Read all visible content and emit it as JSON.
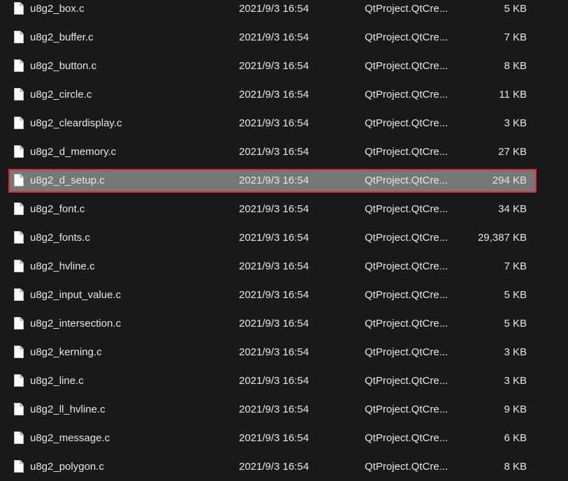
{
  "colors": {
    "background": "#191919",
    "text": "#e6e6e6",
    "selected_background": "#777777",
    "selected_border": "#e8262c",
    "icon_fill": "#ffffff"
  },
  "files": [
    {
      "name": "u8g2_box.c",
      "date": "2021/9/3 16:54",
      "type": "QtProject.QtCre...",
      "size": "5 KB",
      "icon": "document-icon",
      "selected": false
    },
    {
      "name": "u8g2_buffer.c",
      "date": "2021/9/3 16:54",
      "type": "QtProject.QtCre...",
      "size": "7 KB",
      "icon": "document-icon",
      "selected": false
    },
    {
      "name": "u8g2_button.c",
      "date": "2021/9/3 16:54",
      "type": "QtProject.QtCre...",
      "size": "8 KB",
      "icon": "document-icon",
      "selected": false
    },
    {
      "name": "u8g2_circle.c",
      "date": "2021/9/3 16:54",
      "type": "QtProject.QtCre...",
      "size": "11 KB",
      "icon": "document-icon",
      "selected": false
    },
    {
      "name": "u8g2_cleardisplay.c",
      "date": "2021/9/3 16:54",
      "type": "QtProject.QtCre...",
      "size": "3 KB",
      "icon": "document-icon",
      "selected": false
    },
    {
      "name": "u8g2_d_memory.c",
      "date": "2021/9/3 16:54",
      "type": "QtProject.QtCre...",
      "size": "27 KB",
      "icon": "document-icon",
      "selected": false
    },
    {
      "name": "u8g2_d_setup.c",
      "date": "2021/9/3 16:54",
      "type": "QtProject.QtCre...",
      "size": "294 KB",
      "icon": "document-icon",
      "selected": true
    },
    {
      "name": "u8g2_font.c",
      "date": "2021/9/3 16:54",
      "type": "QtProject.QtCre...",
      "size": "34 KB",
      "icon": "document-icon",
      "selected": false
    },
    {
      "name": "u8g2_fonts.c",
      "date": "2021/9/3 16:54",
      "type": "QtProject.QtCre...",
      "size": "29,387 KB",
      "icon": "document-icon",
      "selected": false
    },
    {
      "name": "u8g2_hvline.c",
      "date": "2021/9/3 16:54",
      "type": "QtProject.QtCre...",
      "size": "7 KB",
      "icon": "document-icon",
      "selected": false
    },
    {
      "name": "u8g2_input_value.c",
      "date": "2021/9/3 16:54",
      "type": "QtProject.QtCre...",
      "size": "5 KB",
      "icon": "document-icon",
      "selected": false
    },
    {
      "name": "u8g2_intersection.c",
      "date": "2021/9/3 16:54",
      "type": "QtProject.QtCre...",
      "size": "5 KB",
      "icon": "document-icon",
      "selected": false
    },
    {
      "name": "u8g2_kerning.c",
      "date": "2021/9/3 16:54",
      "type": "QtProject.QtCre...",
      "size": "3 KB",
      "icon": "document-icon",
      "selected": false
    },
    {
      "name": "u8g2_line.c",
      "date": "2021/9/3 16:54",
      "type": "QtProject.QtCre...",
      "size": "3 KB",
      "icon": "document-icon",
      "selected": false
    },
    {
      "name": "u8g2_ll_hvline.c",
      "date": "2021/9/3 16:54",
      "type": "QtProject.QtCre...",
      "size": "9 KB",
      "icon": "document-icon",
      "selected": false
    },
    {
      "name": "u8g2_message.c",
      "date": "2021/9/3 16:54",
      "type": "QtProject.QtCre...",
      "size": "6 KB",
      "icon": "document-icon",
      "selected": false
    },
    {
      "name": "u8g2_polygon.c",
      "date": "2021/9/3 16:54",
      "type": "QtProject.QtCre...",
      "size": "8 KB",
      "icon": "document-icon",
      "selected": false
    }
  ]
}
